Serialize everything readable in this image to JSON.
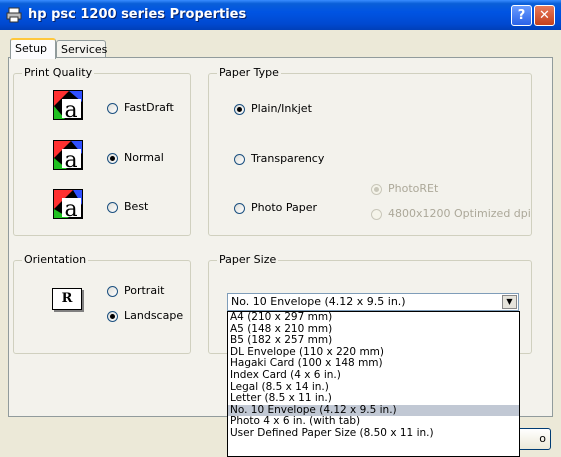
{
  "window": {
    "title": "hp psc 1200 series Properties",
    "help_label": "?",
    "close_label": "✕"
  },
  "tabs": [
    {
      "label": "Setup",
      "active": true
    },
    {
      "label": "Services",
      "active": false
    }
  ],
  "print_quality": {
    "title": "Print Quality",
    "options": [
      {
        "label": "FastDraft",
        "checked": false
      },
      {
        "label": "Normal",
        "checked": true
      },
      {
        "label": "Best",
        "checked": false
      }
    ],
    "icon_glyph": "a"
  },
  "paper_type": {
    "title": "Paper Type",
    "options": [
      {
        "label": "Plain/Inkjet",
        "checked": true
      },
      {
        "label": "Transparency",
        "checked": false
      },
      {
        "label": "Photo Paper",
        "checked": false
      }
    ],
    "photo_options": [
      {
        "label": "PhotoREt",
        "checked": true,
        "disabled": true
      },
      {
        "label": "4800x1200 Optimized dpi",
        "checked": false,
        "disabled": true
      }
    ]
  },
  "orientation": {
    "title": "Orientation",
    "icon_glyph": "R",
    "options": [
      {
        "label": "Portrait",
        "checked": false
      },
      {
        "label": "Landscape",
        "checked": true
      }
    ]
  },
  "paper_size": {
    "title": "Paper Size",
    "selected": "No. 10 Envelope (4.12 x 9.5 in.)",
    "arrow": "▼",
    "options": [
      "A4 (210 x 297 mm)",
      "A5 (148 x 210 mm)",
      "B5 (182 x 257 mm)",
      "DL Envelope (110 x 220 mm)",
      "Hagaki Card (100 x 148 mm)",
      "Index Card (4 x 6 in.)",
      "Legal (8.5 x 14 in.)",
      "Letter (8.5 x 11 in.)",
      "No. 10 Envelope (4.12 x 9.5 in.)",
      "Photo 4 x 6 in. (with tab)",
      "User Defined Paper Size (8.50 x 11 in.)"
    ],
    "highlighted_index": 8
  },
  "buttons": {
    "ok_partial": "o"
  },
  "colors": {
    "titlebar": "#0054e3",
    "close": "#c4401c",
    "highlight": "#c1c8d4"
  }
}
